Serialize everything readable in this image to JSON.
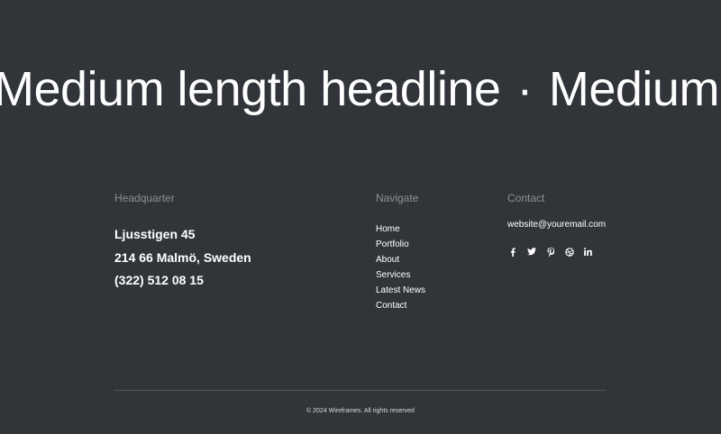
{
  "headline": {
    "text": "Medium length headline",
    "separator": "·",
    "repeat_text": "Medium le"
  },
  "footer": {
    "headquarter": {
      "title": "Headquarter",
      "street": "Ljusstigen 45",
      "city": "214 66 Malmö, Sweden",
      "phone": "(322) 512 08 15"
    },
    "navigate": {
      "title": "Navigate",
      "items": [
        "Home",
        "Portfolio",
        "About",
        "Services",
        "Latest News",
        "Contact"
      ]
    },
    "contact": {
      "title": "Contact",
      "email": "website@youremail.com",
      "socials": [
        "facebook-icon",
        "twitter-icon",
        "pinterest-icon",
        "dribbble-icon",
        "linkedin-icon"
      ]
    },
    "copyright": "© 2024 Wireframes. All rights reserved"
  },
  "colors": {
    "background": "#31353a",
    "muted_text": "#8d9196",
    "text": "#ffffff",
    "divider": "#50555b"
  }
}
